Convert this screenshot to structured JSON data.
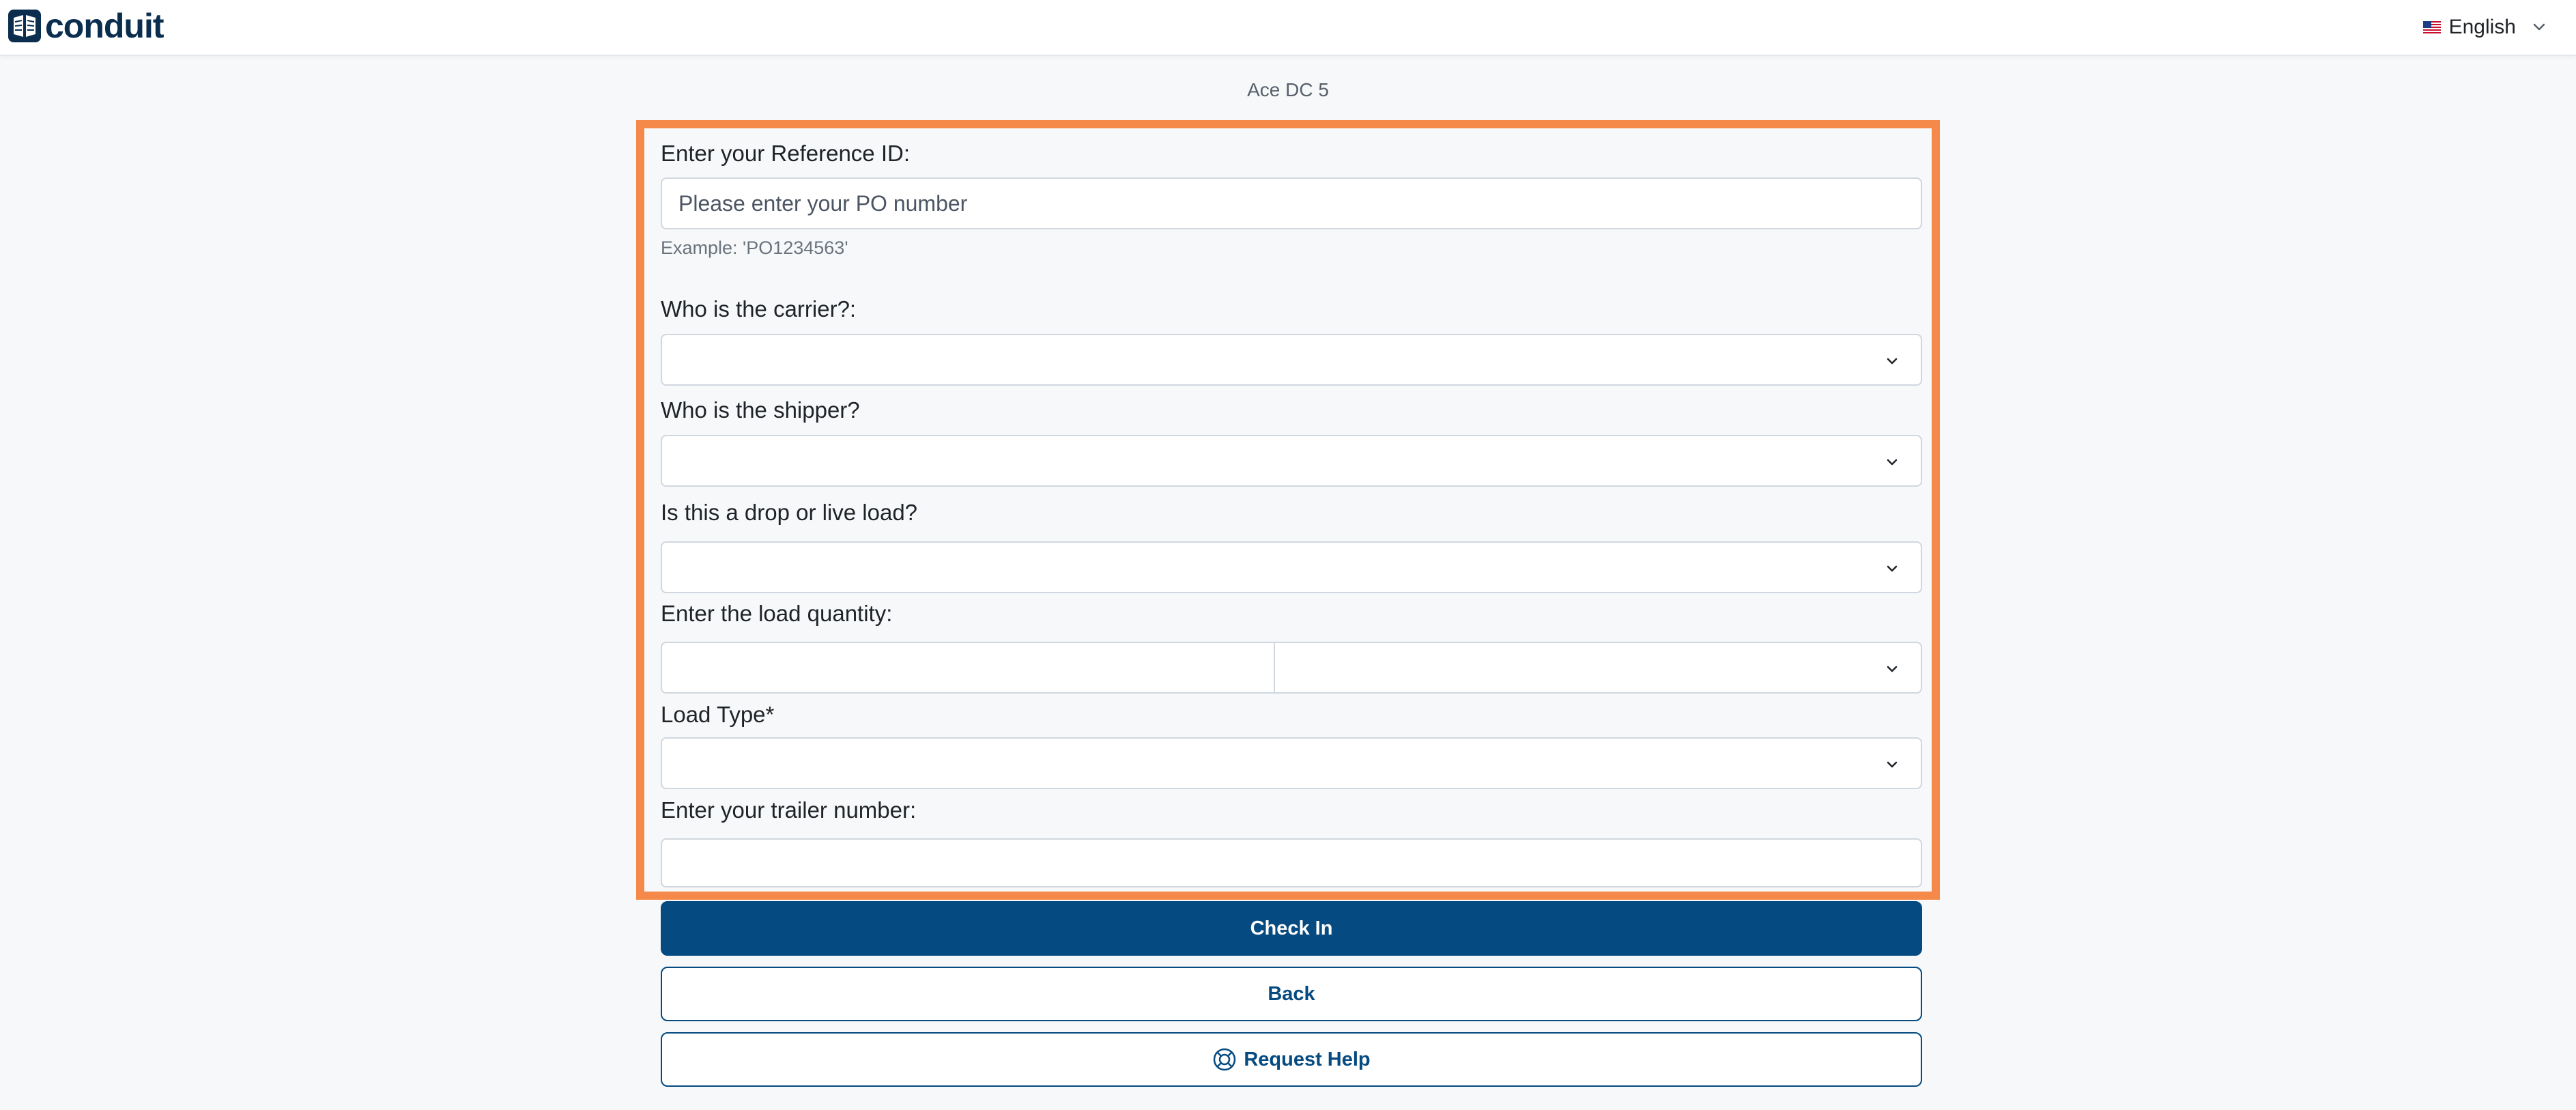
{
  "header": {
    "logo_text": "conduit",
    "language": "English",
    "language_flag_icon": "us-flag-icon"
  },
  "site_name": "Ace DC 5",
  "form": {
    "reference": {
      "label": "Enter your Reference ID:",
      "placeholder": "Please enter your PO number",
      "value": "",
      "hint": "Example: 'PO1234563'"
    },
    "carrier": {
      "label": "Who is the carrier?:",
      "value": ""
    },
    "shipper": {
      "label": "Who is the shipper?",
      "value": ""
    },
    "load_mode": {
      "label": "Is this a drop or live load?",
      "value": ""
    },
    "load_quantity": {
      "label": "Enter the load quantity:",
      "quantity_value": "",
      "unit_value": ""
    },
    "load_type": {
      "label": "Load Type*",
      "value": ""
    },
    "trailer": {
      "label": "Enter your trailer number:",
      "value": ""
    }
  },
  "actions": {
    "check_in_label": "Check In",
    "back_label": "Back",
    "request_help_label": "Request Help"
  },
  "colors": {
    "primary": "#054a80",
    "highlight_border": "#f5894a",
    "background": "#f6f8fa"
  }
}
